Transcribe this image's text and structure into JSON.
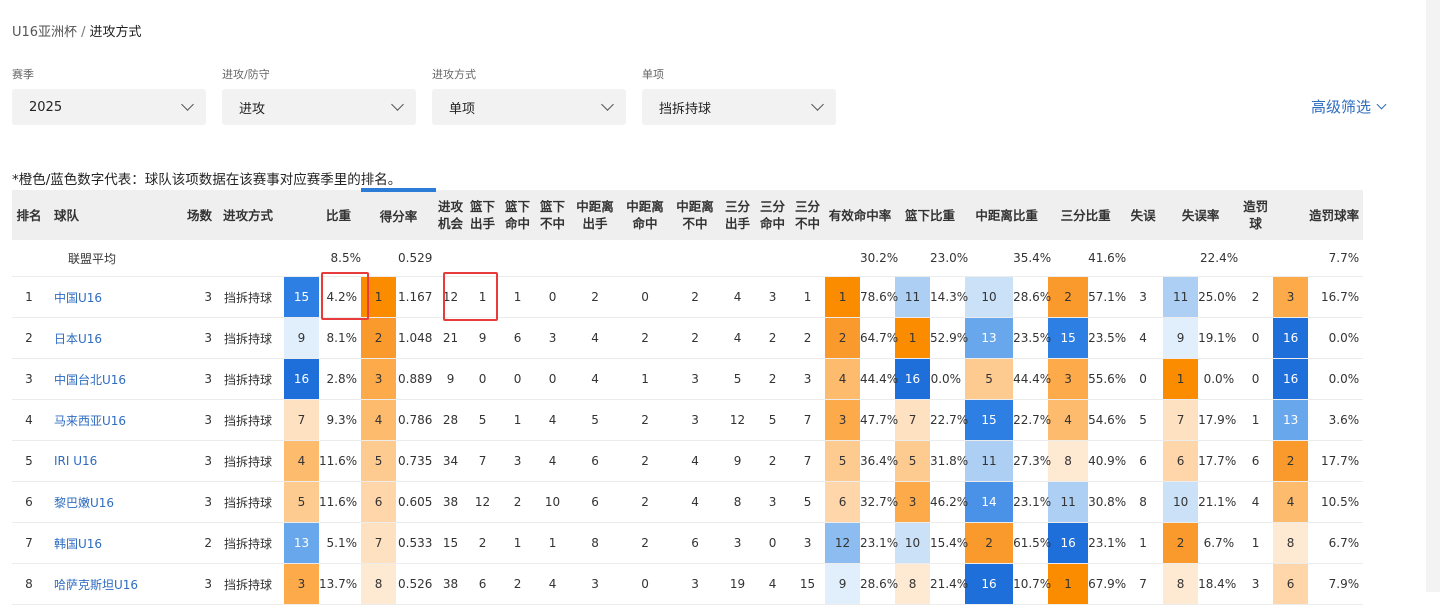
{
  "breadcrumb": {
    "parent": "U16亚洲杯",
    "separator": "/",
    "current": "进攻方式"
  },
  "filters": [
    {
      "label": "赛季",
      "value": "2025"
    },
    {
      "label": "进攻/防守",
      "value": "进攻"
    },
    {
      "label": "进攻方式",
      "value": "单项"
    },
    {
      "label": "单项",
      "value": "挡拆持球"
    }
  ],
  "advanced_filter_label": "高级筛选",
  "note": "*橙色/蓝色数字代表：球队该项数据在该赛事对应赛季里的排名。",
  "columns": [
    {
      "key": "rank",
      "label": "排名"
    },
    {
      "key": "team",
      "label": "球队"
    },
    {
      "key": "games",
      "label": "场数"
    },
    {
      "key": "method",
      "label": "进攻方式"
    },
    {
      "key": "ratio",
      "label": "比重"
    },
    {
      "key": "ppp",
      "label": "得分率",
      "sorted": true
    },
    {
      "key": "poss",
      "label": "进攻\n机会"
    },
    {
      "key": "rim_att",
      "label": "篮下\n出手"
    },
    {
      "key": "rim_made",
      "label": "篮下\n命中"
    },
    {
      "key": "rim_miss",
      "label": "篮下\n不中"
    },
    {
      "key": "mid_att",
      "label": "中距离\n出手"
    },
    {
      "key": "mid_made",
      "label": "中距离\n命中"
    },
    {
      "key": "mid_miss",
      "label": "中距离\n不中"
    },
    {
      "key": "three_att",
      "label": "三分\n出手"
    },
    {
      "key": "three_made",
      "label": "三分\n命中"
    },
    {
      "key": "three_miss",
      "label": "三分\n不中"
    },
    {
      "key": "efg",
      "label": "有效命中率"
    },
    {
      "key": "rim_pct",
      "label": "篮下比重"
    },
    {
      "key": "mid_pct",
      "label": "中距离比重"
    },
    {
      "key": "three_pct",
      "label": "三分比重"
    },
    {
      "key": "tov",
      "label": "失误"
    },
    {
      "key": "tov_pct",
      "label": "失误率"
    },
    {
      "key": "fd",
      "label": "造罚球"
    },
    {
      "key": "fd_pct",
      "label": "造罚球率"
    }
  ],
  "league_average": {
    "label": "联盟平均",
    "ratio": "8.5%",
    "ppp": "0.529",
    "efg": "30.2%",
    "rim_pct": "23.0%",
    "mid_pct": "35.4%",
    "three_pct": "41.6%",
    "tov_pct": "22.4%",
    "fd_pct": "7.7%"
  },
  "rank_colors": {
    "1": "#fb8c00",
    "2": "#fb9a2c",
    "3": "#fcaa4a",
    "4": "#fdbb6d",
    "5": "#fdca90",
    "6": "#fed6a9",
    "7": "#fee1c0",
    "8": "#fee9d3",
    "9": "#e1eefb",
    "10": "#cbe1f7",
    "11": "#adcff4",
    "12": "#8dbcf0",
    "13": "#69a7ec",
    "14": "#4a92e8",
    "15": "#2e7fe4",
    "16": "#1e6fd9"
  },
  "rows": [
    {
      "rank": "1",
      "team": "中国U16",
      "games": "3",
      "method": "挡拆持球",
      "ratio_rank": "15",
      "ratio": "4.2%",
      "ppp_rank": "1",
      "ppp": "1.167",
      "poss": "12",
      "rim_att": "1",
      "rim_made": "1",
      "rim_miss": "0",
      "mid_att": "2",
      "mid_made": "0",
      "mid_miss": "2",
      "three_att": "4",
      "three_made": "3",
      "three_miss": "1",
      "efg_rank": "1",
      "efg": "78.6%",
      "rim_rank": "11",
      "rim_pct": "14.3%",
      "mid_rank": "10",
      "mid_pct": "28.6%",
      "three_rank": "2",
      "three_pct": "57.1%",
      "tov": "3",
      "tov_rank": "11",
      "tov_pct": "25.0%",
      "fd": "2",
      "fd_rank": "3",
      "fd_pct": "16.7%"
    },
    {
      "rank": "2",
      "team": "日本U16",
      "games": "3",
      "method": "挡拆持球",
      "ratio_rank": "9",
      "ratio": "8.1%",
      "ppp_rank": "2",
      "ppp": "1.048",
      "poss": "21",
      "rim_att": "9",
      "rim_made": "6",
      "rim_miss": "3",
      "mid_att": "4",
      "mid_made": "2",
      "mid_miss": "2",
      "three_att": "4",
      "three_made": "2",
      "three_miss": "2",
      "efg_rank": "2",
      "efg": "64.7%",
      "rim_rank": "1",
      "rim_pct": "52.9%",
      "mid_rank": "13",
      "mid_pct": "23.5%",
      "three_rank": "15",
      "three_pct": "23.5%",
      "tov": "4",
      "tov_rank": "9",
      "tov_pct": "19.1%",
      "fd": "0",
      "fd_rank": "16",
      "fd_pct": "0.0%"
    },
    {
      "rank": "3",
      "team": "中国台北U16",
      "games": "3",
      "method": "挡拆持球",
      "ratio_rank": "16",
      "ratio": "2.8%",
      "ppp_rank": "3",
      "ppp": "0.889",
      "poss": "9",
      "rim_att": "0",
      "rim_made": "0",
      "rim_miss": "0",
      "mid_att": "4",
      "mid_made": "1",
      "mid_miss": "3",
      "three_att": "5",
      "three_made": "2",
      "three_miss": "3",
      "efg_rank": "4",
      "efg": "44.4%",
      "rim_rank": "16",
      "rim_pct": "0.0%",
      "mid_rank": "5",
      "mid_pct": "44.4%",
      "three_rank": "3",
      "three_pct": "55.6%",
      "tov": "0",
      "tov_rank": "1",
      "tov_pct": "0.0%",
      "fd": "0",
      "fd_rank": "16",
      "fd_pct": "0.0%"
    },
    {
      "rank": "4",
      "team": "马来西亚U16",
      "games": "3",
      "method": "挡拆持球",
      "ratio_rank": "7",
      "ratio": "9.3%",
      "ppp_rank": "4",
      "ppp": "0.786",
      "poss": "28",
      "rim_att": "5",
      "rim_made": "1",
      "rim_miss": "4",
      "mid_att": "5",
      "mid_made": "2",
      "mid_miss": "3",
      "three_att": "12",
      "three_made": "5",
      "three_miss": "7",
      "efg_rank": "3",
      "efg": "47.7%",
      "rim_rank": "7",
      "rim_pct": "22.7%",
      "mid_rank": "15",
      "mid_pct": "22.7%",
      "three_rank": "4",
      "three_pct": "54.6%",
      "tov": "5",
      "tov_rank": "7",
      "tov_pct": "17.9%",
      "fd": "1",
      "fd_rank": "13",
      "fd_pct": "3.6%"
    },
    {
      "rank": "5",
      "team": "IRI U16",
      "games": "3",
      "method": "挡拆持球",
      "ratio_rank": "4",
      "ratio": "11.6%",
      "ppp_rank": "5",
      "ppp": "0.735",
      "poss": "34",
      "rim_att": "7",
      "rim_made": "3",
      "rim_miss": "4",
      "mid_att": "6",
      "mid_made": "2",
      "mid_miss": "4",
      "three_att": "9",
      "three_made": "2",
      "three_miss": "7",
      "efg_rank": "5",
      "efg": "36.4%",
      "rim_rank": "5",
      "rim_pct": "31.8%",
      "mid_rank": "11",
      "mid_pct": "27.3%",
      "three_rank": "8",
      "three_pct": "40.9%",
      "tov": "6",
      "tov_rank": "6",
      "tov_pct": "17.7%",
      "fd": "6",
      "fd_rank": "2",
      "fd_pct": "17.7%"
    },
    {
      "rank": "6",
      "team": "黎巴嫩U16",
      "games": "3",
      "method": "挡拆持球",
      "ratio_rank": "5",
      "ratio": "11.6%",
      "ppp_rank": "6",
      "ppp": "0.605",
      "poss": "38",
      "rim_att": "12",
      "rim_made": "2",
      "rim_miss": "10",
      "mid_att": "6",
      "mid_made": "2",
      "mid_miss": "4",
      "three_att": "8",
      "three_made": "3",
      "three_miss": "5",
      "efg_rank": "6",
      "efg": "32.7%",
      "rim_rank": "3",
      "rim_pct": "46.2%",
      "mid_rank": "14",
      "mid_pct": "23.1%",
      "three_rank": "11",
      "three_pct": "30.8%",
      "tov": "8",
      "tov_rank": "10",
      "tov_pct": "21.1%",
      "fd": "4",
      "fd_rank": "4",
      "fd_pct": "10.5%"
    },
    {
      "rank": "7",
      "team": "韩国U16",
      "games": "2",
      "method": "挡拆持球",
      "ratio_rank": "13",
      "ratio": "5.1%",
      "ppp_rank": "7",
      "ppp": "0.533",
      "poss": "15",
      "rim_att": "2",
      "rim_made": "1",
      "rim_miss": "1",
      "mid_att": "8",
      "mid_made": "2",
      "mid_miss": "6",
      "three_att": "3",
      "three_made": "0",
      "three_miss": "3",
      "efg_rank": "12",
      "efg": "23.1%",
      "rim_rank": "10",
      "rim_pct": "15.4%",
      "mid_rank": "2",
      "mid_pct": "61.5%",
      "three_rank": "16",
      "three_pct": "23.1%",
      "tov": "1",
      "tov_rank": "2",
      "tov_pct": "6.7%",
      "fd": "1",
      "fd_rank": "8",
      "fd_pct": "6.7%"
    },
    {
      "rank": "8",
      "team": "哈萨克斯坦U16",
      "games": "3",
      "method": "挡拆持球",
      "ratio_rank": "3",
      "ratio": "13.7%",
      "ppp_rank": "8",
      "ppp": "0.526",
      "poss": "38",
      "rim_att": "6",
      "rim_made": "2",
      "rim_miss": "4",
      "mid_att": "3",
      "mid_made": "0",
      "mid_miss": "3",
      "three_att": "19",
      "three_made": "4",
      "three_miss": "15",
      "efg_rank": "9",
      "efg": "28.6%",
      "rim_rank": "8",
      "rim_pct": "21.4%",
      "mid_rank": "16",
      "mid_pct": "10.7%",
      "three_rank": "1",
      "three_pct": "67.9%",
      "tov": "7",
      "tov_rank": "8",
      "tov_pct": "18.4%",
      "fd": "3",
      "fd_rank": "6",
      "fd_pct": "7.9%"
    }
  ]
}
